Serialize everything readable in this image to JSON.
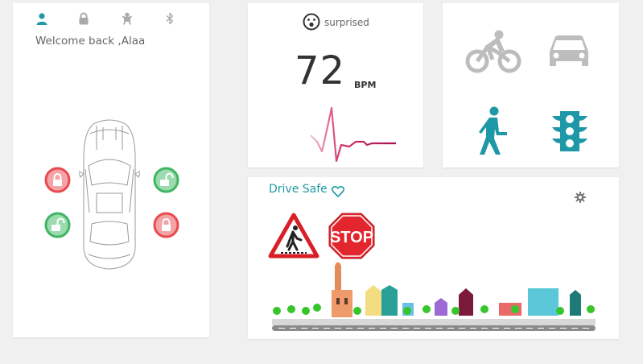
{
  "user": {
    "welcome_text": "Welcome back ,Alaa"
  },
  "tabs": [
    {
      "name": "person-icon",
      "active": true
    },
    {
      "name": "lock-icon",
      "active": false
    },
    {
      "name": "baby-icon",
      "active": false
    },
    {
      "name": "bluetooth-icon",
      "active": false
    }
  ],
  "doors": [
    {
      "position": "front-left",
      "state": "locked",
      "color": "#e94a4f"
    },
    {
      "position": "front-right",
      "state": "unlocked",
      "color": "#3fb563"
    },
    {
      "position": "rear-left",
      "state": "unlocked",
      "color": "#3fb563"
    },
    {
      "position": "rear-right",
      "state": "locked",
      "color": "#e94a4f"
    }
  ],
  "emotion": {
    "label": "surprised",
    "icon": "surprised-face-icon"
  },
  "heart_rate": {
    "value": "72",
    "unit": "BPM"
  },
  "modes": [
    {
      "name": "bicycle-icon",
      "active": false
    },
    {
      "name": "car-icon",
      "active": false
    },
    {
      "name": "pedestrian-icon",
      "active": true
    },
    {
      "name": "traffic-light-icon",
      "active": true
    }
  ],
  "drive": {
    "title": "Drive Safe",
    "stop_sign_text": "STOP"
  },
  "colors": {
    "accent": "#1f9aa3",
    "inactive": "#bdbdbd",
    "heartbeat": "#b5165a",
    "locked": "#e94a4f",
    "unlocked": "#3fb563"
  }
}
